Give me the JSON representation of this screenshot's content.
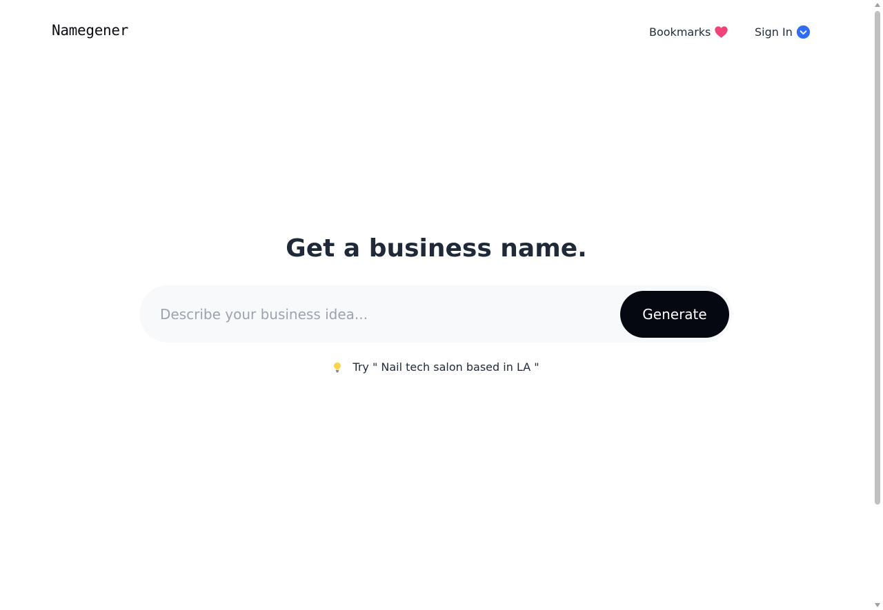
{
  "header": {
    "logo": "Namegener",
    "bookmarks_label": "Bookmarks",
    "bookmarks_icon": "heart-icon",
    "signin_label": "Sign In",
    "signin_icon": "chevron-down-circle-icon"
  },
  "hero": {
    "title": "Get a business name.",
    "input_placeholder": "Describe your business idea...",
    "input_value": "",
    "generate_label": "Generate",
    "suggestion_icon": "lightbulb-icon",
    "suggestion_text": "Try \" Nail tech salon based in LA \""
  },
  "colors": {
    "heart": "#f0437a",
    "signin_accent": "#2f6df6",
    "button_bg": "#050711",
    "input_bg": "#f8f9fb",
    "text": "#1f2937"
  }
}
